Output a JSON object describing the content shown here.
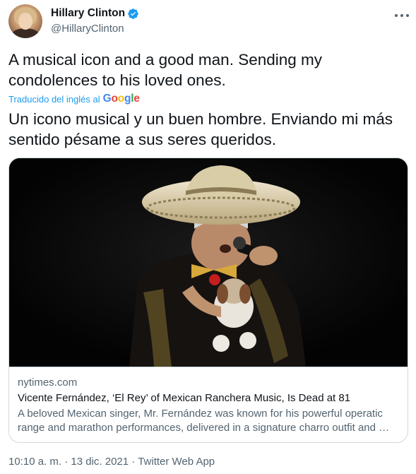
{
  "author": {
    "display_name": "Hillary Clinton",
    "handle": "@HillaryClinton",
    "verified_badge_icon": "verified-badge-icon",
    "avatar_icon": "avatar"
  },
  "tweet": {
    "text": "A musical icon and a good man. Sending my condolences to his loved ones.",
    "translated_from": "Traducido del inglés al",
    "translator_brand": "Google",
    "translation": "Un icono musical y un buen hombre. Enviando mi más sentido pésame a sus seres queridos."
  },
  "card": {
    "domain": "nytimes.com",
    "title": "Vicente Fernández, ‘El Rey’ of Mexican Ranchera Music, Is Dead at 81",
    "description": "A beloved Mexican singer, Mr. Fernández was known for his powerful operatic range and marathon performances, delivered in a signature charro outfit and …"
  },
  "meta": {
    "time": "10:10 a. m.",
    "separator": "·",
    "date": "13 dic. 2021",
    "source": "Twitter Web App"
  },
  "colors": {
    "accent": "#1d9bf0",
    "text": "#0f1419",
    "muted": "#536471",
    "border": "#cfd9de"
  }
}
